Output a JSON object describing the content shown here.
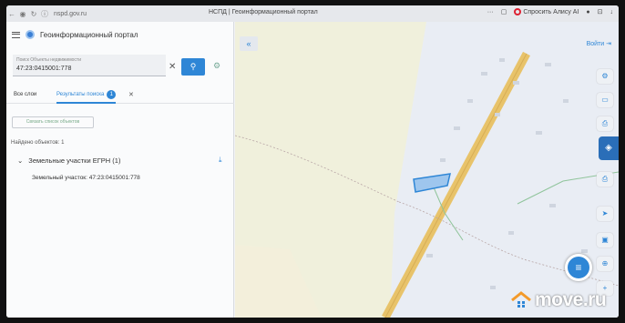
{
  "browser": {
    "url": "nspd.gov.ru",
    "tab_title": "НСПД | Геоинформационный портал",
    "alice_label": "Спросить Алису AI"
  },
  "panel": {
    "title": "Геоинформационный портал",
    "search": {
      "placeholder": "Поиск Объекты недвижимости",
      "value": "47:23:0415001:778"
    },
    "tabs": {
      "all_layers": "Все слои",
      "results": "Результаты поиска",
      "results_count": "1"
    },
    "link_button": "Связать список объектов",
    "found_label": "Найдено объектов: 1",
    "group_label": "Земельные участки ЕГРН (1)",
    "item_label": "Земельный участок: 47:23:0415001:778"
  },
  "map": {
    "login_label": "Войти",
    "colors": {
      "road": "#e8c36a",
      "parcel_fill": "#9ec6ee",
      "parcel_stroke": "#2e86d6",
      "settlement": "#e9edf4",
      "map_bg": "#f0f0dc"
    }
  },
  "watermark": {
    "text": "move.ru"
  }
}
